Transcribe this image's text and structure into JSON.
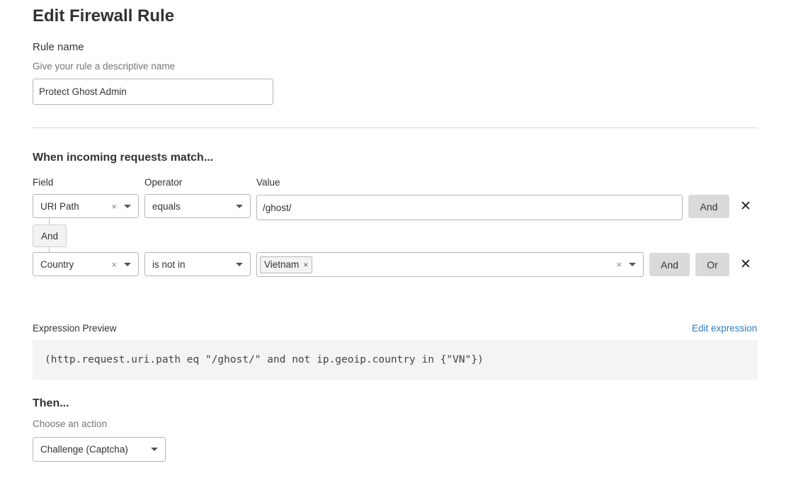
{
  "page": {
    "title": "Edit Firewall Rule"
  },
  "rule_name": {
    "label": "Rule name",
    "hint": "Give your rule a descriptive name",
    "value": "Protect Ghost Admin"
  },
  "match": {
    "heading": "When incoming requests match...",
    "columns": {
      "field": "Field",
      "operator": "Operator",
      "value": "Value"
    },
    "conditions": [
      {
        "field": "URI Path",
        "operator": "equals",
        "value": "/ghost/",
        "buttons": [
          "And"
        ]
      },
      {
        "field": "Country",
        "operator": "is not in",
        "tags": [
          "Vietnam"
        ],
        "buttons": [
          "And",
          "Or"
        ]
      }
    ],
    "connector": "And",
    "clear_symbol": "×",
    "remove_symbol": "✕"
  },
  "expression": {
    "label": "Expression Preview",
    "edit_link": "Edit expression",
    "text": "(http.request.uri.path eq \"/ghost/\" and not ip.geoip.country in {\"VN\"})"
  },
  "action": {
    "heading": "Then...",
    "hint": "Choose an action",
    "value": "Challenge (Captcha)"
  },
  "colors": {
    "link": "#2f7bbf",
    "button_grey": "#dadada",
    "border": "#b7b7b7"
  }
}
